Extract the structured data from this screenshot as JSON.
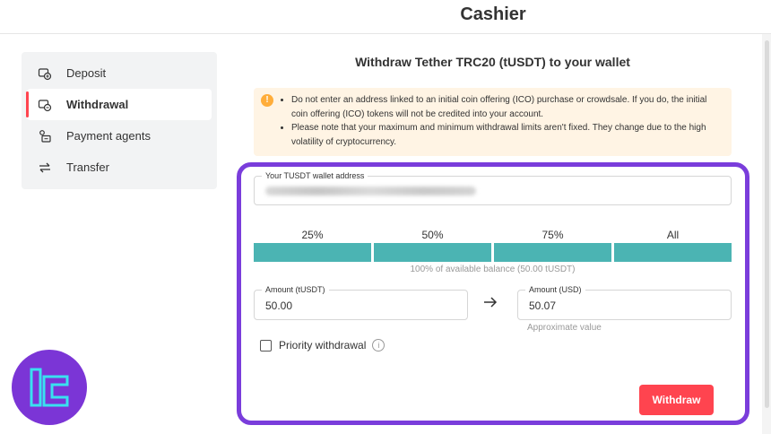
{
  "header": {
    "title": "Cashier"
  },
  "sidebar": {
    "items": [
      {
        "label": "Deposit",
        "icon": "deposit-icon",
        "active": false
      },
      {
        "label": "Withdrawal",
        "icon": "withdrawal-icon",
        "active": true
      },
      {
        "label": "Payment agents",
        "icon": "payment-agents-icon",
        "active": false
      },
      {
        "label": "Transfer",
        "icon": "transfer-icon",
        "active": false
      }
    ]
  },
  "main": {
    "title": "Withdraw Tether TRC20 (tUSDT) to your wallet",
    "notice": {
      "icon": "warning-icon",
      "items": [
        "Do not enter an address linked to an initial coin offering (ICO) purchase or crowdsale. If you do, the initial coin offering (ICO) tokens will not be credited into your account.",
        "Please note that your maximum and minimum withdrawal limits aren't fixed. They change due to the high volatility of cryptocurrency."
      ]
    },
    "wallet": {
      "label": "Your TUSDT wallet address",
      "value_hidden": true
    },
    "percentages": [
      "25%",
      "50%",
      "75%",
      "All"
    ],
    "balance_note": "100% of available balance (50.00 tUSDT)",
    "amount_crypto": {
      "label": "Amount (tUSDT)",
      "value": "50.00"
    },
    "amount_fiat": {
      "label": "Amount (USD)",
      "value": "50.07",
      "hint": "Approximate value"
    },
    "priority": {
      "label": "Priority withdrawal",
      "checked": false
    },
    "withdraw_label": "Withdraw"
  },
  "colors": {
    "accent_red": "#ff444f",
    "teal": "#4bb4b3",
    "highlight_purple": "#7a3ddb",
    "notice_bg": "#fff4e4",
    "warning_orange": "#ffad3a"
  }
}
